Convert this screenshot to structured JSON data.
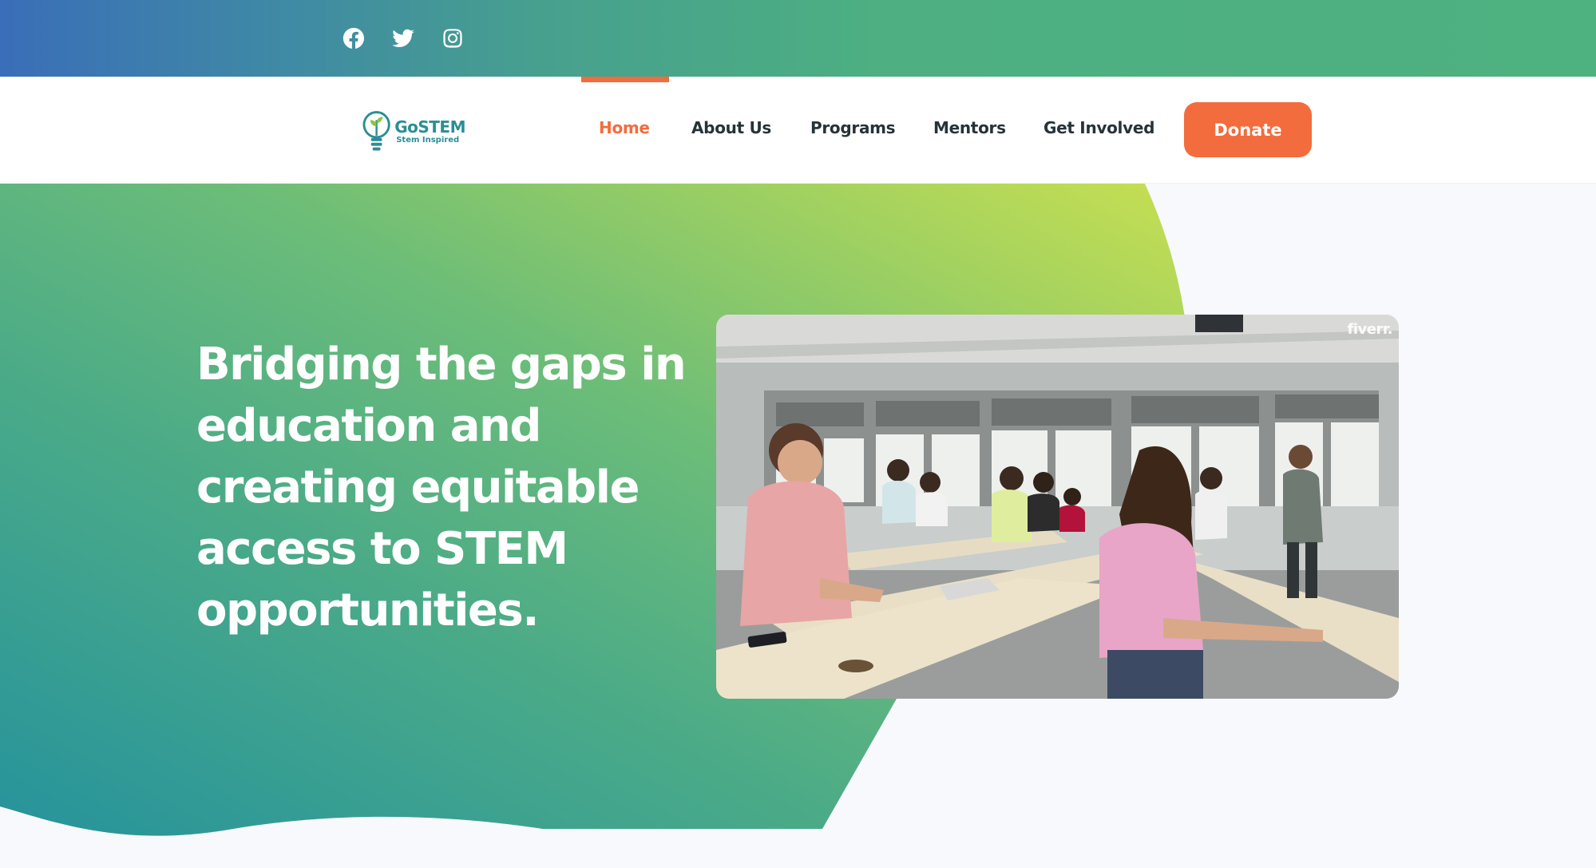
{
  "social": {
    "facebook": "facebook-icon",
    "twitter": "twitter-icon",
    "instagram": "instagram-icon"
  },
  "brand": {
    "name": "GoSTEM",
    "tagline": "Stem Inspired"
  },
  "nav": {
    "items": [
      {
        "label": "Home",
        "active": true
      },
      {
        "label": "About Us",
        "active": false
      },
      {
        "label": "Programs",
        "active": false
      },
      {
        "label": "Mentors",
        "active": false
      },
      {
        "label": "Get Involved",
        "active": false
      }
    ],
    "donate_label": "Donate"
  },
  "hero": {
    "heading_lines": [
      "Bridging the gaps in",
      "education and",
      "creating equitable",
      "access to STEM",
      "opportunities."
    ],
    "image_watermark": "fiverr."
  },
  "colors": {
    "accent": "#f36c3d",
    "brand_teal": "#2a8f95",
    "gradient_start": "#2a8f9a",
    "gradient_end": "#c4dd55"
  }
}
